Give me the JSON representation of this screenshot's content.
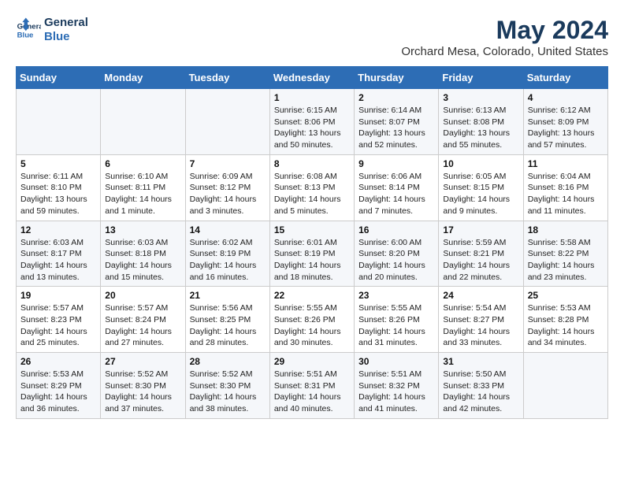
{
  "logo": {
    "line1": "General",
    "line2": "Blue"
  },
  "title": "May 2024",
  "subtitle": "Orchard Mesa, Colorado, United States",
  "weekdays": [
    "Sunday",
    "Monday",
    "Tuesday",
    "Wednesday",
    "Thursday",
    "Friday",
    "Saturday"
  ],
  "weeks": [
    [
      {
        "day": "",
        "info": ""
      },
      {
        "day": "",
        "info": ""
      },
      {
        "day": "",
        "info": ""
      },
      {
        "day": "1",
        "info": "Sunrise: 6:15 AM\nSunset: 8:06 PM\nDaylight: 13 hours\nand 50 minutes."
      },
      {
        "day": "2",
        "info": "Sunrise: 6:14 AM\nSunset: 8:07 PM\nDaylight: 13 hours\nand 52 minutes."
      },
      {
        "day": "3",
        "info": "Sunrise: 6:13 AM\nSunset: 8:08 PM\nDaylight: 13 hours\nand 55 minutes."
      },
      {
        "day": "4",
        "info": "Sunrise: 6:12 AM\nSunset: 8:09 PM\nDaylight: 13 hours\nand 57 minutes."
      }
    ],
    [
      {
        "day": "5",
        "info": "Sunrise: 6:11 AM\nSunset: 8:10 PM\nDaylight: 13 hours\nand 59 minutes."
      },
      {
        "day": "6",
        "info": "Sunrise: 6:10 AM\nSunset: 8:11 PM\nDaylight: 14 hours\nand 1 minute."
      },
      {
        "day": "7",
        "info": "Sunrise: 6:09 AM\nSunset: 8:12 PM\nDaylight: 14 hours\nand 3 minutes."
      },
      {
        "day": "8",
        "info": "Sunrise: 6:08 AM\nSunset: 8:13 PM\nDaylight: 14 hours\nand 5 minutes."
      },
      {
        "day": "9",
        "info": "Sunrise: 6:06 AM\nSunset: 8:14 PM\nDaylight: 14 hours\nand 7 minutes."
      },
      {
        "day": "10",
        "info": "Sunrise: 6:05 AM\nSunset: 8:15 PM\nDaylight: 14 hours\nand 9 minutes."
      },
      {
        "day": "11",
        "info": "Sunrise: 6:04 AM\nSunset: 8:16 PM\nDaylight: 14 hours\nand 11 minutes."
      }
    ],
    [
      {
        "day": "12",
        "info": "Sunrise: 6:03 AM\nSunset: 8:17 PM\nDaylight: 14 hours\nand 13 minutes."
      },
      {
        "day": "13",
        "info": "Sunrise: 6:03 AM\nSunset: 8:18 PM\nDaylight: 14 hours\nand 15 minutes."
      },
      {
        "day": "14",
        "info": "Sunrise: 6:02 AM\nSunset: 8:19 PM\nDaylight: 14 hours\nand 16 minutes."
      },
      {
        "day": "15",
        "info": "Sunrise: 6:01 AM\nSunset: 8:19 PM\nDaylight: 14 hours\nand 18 minutes."
      },
      {
        "day": "16",
        "info": "Sunrise: 6:00 AM\nSunset: 8:20 PM\nDaylight: 14 hours\nand 20 minutes."
      },
      {
        "day": "17",
        "info": "Sunrise: 5:59 AM\nSunset: 8:21 PM\nDaylight: 14 hours\nand 22 minutes."
      },
      {
        "day": "18",
        "info": "Sunrise: 5:58 AM\nSunset: 8:22 PM\nDaylight: 14 hours\nand 23 minutes."
      }
    ],
    [
      {
        "day": "19",
        "info": "Sunrise: 5:57 AM\nSunset: 8:23 PM\nDaylight: 14 hours\nand 25 minutes."
      },
      {
        "day": "20",
        "info": "Sunrise: 5:57 AM\nSunset: 8:24 PM\nDaylight: 14 hours\nand 27 minutes."
      },
      {
        "day": "21",
        "info": "Sunrise: 5:56 AM\nSunset: 8:25 PM\nDaylight: 14 hours\nand 28 minutes."
      },
      {
        "day": "22",
        "info": "Sunrise: 5:55 AM\nSunset: 8:26 PM\nDaylight: 14 hours\nand 30 minutes."
      },
      {
        "day": "23",
        "info": "Sunrise: 5:55 AM\nSunset: 8:26 PM\nDaylight: 14 hours\nand 31 minutes."
      },
      {
        "day": "24",
        "info": "Sunrise: 5:54 AM\nSunset: 8:27 PM\nDaylight: 14 hours\nand 33 minutes."
      },
      {
        "day": "25",
        "info": "Sunrise: 5:53 AM\nSunset: 8:28 PM\nDaylight: 14 hours\nand 34 minutes."
      }
    ],
    [
      {
        "day": "26",
        "info": "Sunrise: 5:53 AM\nSunset: 8:29 PM\nDaylight: 14 hours\nand 36 minutes."
      },
      {
        "day": "27",
        "info": "Sunrise: 5:52 AM\nSunset: 8:30 PM\nDaylight: 14 hours\nand 37 minutes."
      },
      {
        "day": "28",
        "info": "Sunrise: 5:52 AM\nSunset: 8:30 PM\nDaylight: 14 hours\nand 38 minutes."
      },
      {
        "day": "29",
        "info": "Sunrise: 5:51 AM\nSunset: 8:31 PM\nDaylight: 14 hours\nand 40 minutes."
      },
      {
        "day": "30",
        "info": "Sunrise: 5:51 AM\nSunset: 8:32 PM\nDaylight: 14 hours\nand 41 minutes."
      },
      {
        "day": "31",
        "info": "Sunrise: 5:50 AM\nSunset: 8:33 PM\nDaylight: 14 hours\nand 42 minutes."
      },
      {
        "day": "",
        "info": ""
      }
    ]
  ]
}
